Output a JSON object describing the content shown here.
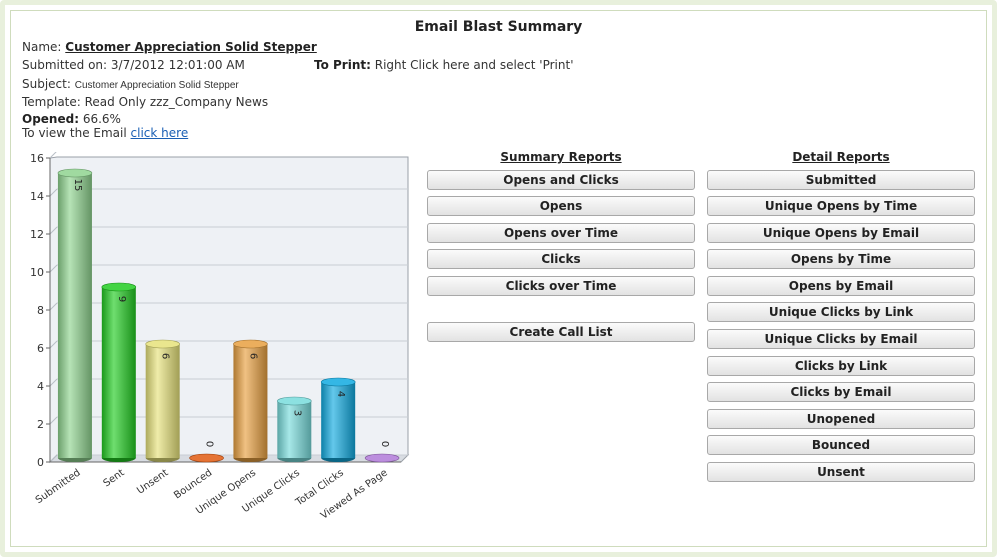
{
  "page_title": "Email Blast Summary",
  "info": {
    "name_label": "Name:",
    "name_value": "Customer Appreciation Solid Stepper",
    "submitted": "Submitted on: 3/7/2012 12:01:00 AM",
    "subject_label": "Subject:",
    "subject_value": "Customer Appreciation Solid Stepper",
    "template": "Template: Read Only zzz_Company News",
    "opened_label": "Opened:",
    "opened_value": "66.6%",
    "view_text": "To view the Email",
    "view_link": "click here",
    "print_label": "To Print:",
    "print_text": "Right Click here and select 'Print'"
  },
  "summary_reports": {
    "title": "Summary Reports",
    "buttons": [
      "Opens and Clicks",
      "Opens",
      "Opens over Time",
      "Clicks",
      "Clicks over Time"
    ],
    "call_list": "Create Call List"
  },
  "detail_reports": {
    "title": "Detail Reports",
    "buttons": [
      "Submitted",
      "Unique Opens by Time",
      "Unique Opens by Email",
      "Opens by Time",
      "Opens by Email",
      "Unique Clicks by Link",
      "Unique Clicks by Email",
      "Clicks by Link",
      "Clicks by Email",
      "Unopened",
      "Bounced",
      "Unsent"
    ]
  },
  "chart_data": {
    "type": "bar",
    "title": "",
    "xlabel": "",
    "ylabel": "",
    "categories": [
      "Submitted",
      "Sent",
      "Unsent",
      "Bounced",
      "Unique Opens",
      "Unique Clicks",
      "Total Clicks",
      "Viewed As Page"
    ],
    "values": [
      15,
      9,
      6,
      0,
      6,
      3,
      4,
      0
    ],
    "ylim": [
      0,
      16
    ],
    "yticks": [
      0,
      2,
      4,
      6,
      8,
      10,
      12,
      14,
      16
    ],
    "grid": true,
    "colors": [
      "#8fd48f",
      "#22cc22",
      "#e6e27a",
      "#e05a10",
      "#e8a040",
      "#78dcdc",
      "#10aae0",
      "#b07ad8"
    ]
  }
}
